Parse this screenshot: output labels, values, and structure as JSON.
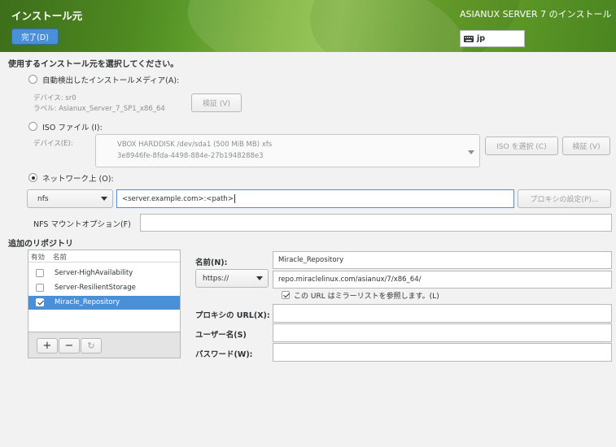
{
  "header": {
    "title": "インストール元",
    "done_label": "完了(D)",
    "product_title": "ASIANUX SERVER 7 のインストール",
    "keyboard_layout": "jp"
  },
  "source": {
    "heading": "使用するインストール元を選択してください。",
    "auto": {
      "label": "自動検出したインストールメディア(A):",
      "device_line": "デバイス: sr0",
      "label_line": "ラベル: Asianux_Server_7_SP1_x86_64",
      "verify_label": "検証 (V)"
    },
    "iso": {
      "label": "ISO ファイル (I):",
      "device_label": "デバイス(E):",
      "device_line1": "VBOX HARDDISK /dev/sda1 (500 MiB MB) xfs",
      "device_line2": "3e8946fe-8fda-4498-884e-27b1948288e3",
      "select_iso_label": "ISO を選択 (C)",
      "verify_label": "検証 (V)"
    },
    "network": {
      "label": "ネットワーク上 (O):",
      "protocol": "nfs",
      "url_value": "<server.example.com>:<path>",
      "proxy_label": "プロキシの設定(P)...",
      "nfs_options_label": "NFS マウントオプション(F)",
      "nfs_options_value": ""
    },
    "selected": "network"
  },
  "repos": {
    "heading": "追加のリポジトリ",
    "col_enabled": "有効",
    "col_name": "名前",
    "items": [
      {
        "name": "Server-HighAvailability",
        "enabled": false
      },
      {
        "name": "Server-ResilientStorage",
        "enabled": false
      },
      {
        "name": "Miracle_Repository",
        "enabled": true,
        "selected": true
      }
    ],
    "add_symbol": "+",
    "remove_symbol": "−",
    "reset_symbol": "↻"
  },
  "repo_detail": {
    "name_label": "名前(N):",
    "name_value": "Miracle_Repository",
    "protocol": "https://",
    "url_value": "repo.miraclelinux.com/asianux/7/x86_64/",
    "mirrorlist_label": "この URL はミラーリストを参照します。(L)",
    "mirrorlist_checked": true,
    "proxy_url_label": "プロキシの URL(X):",
    "proxy_url_value": "",
    "username_label": "ユーザー名(S)",
    "username_value": "",
    "password_label": "パスワード(W):",
    "password_value": ""
  },
  "colors": {
    "accent": "#4a90d9",
    "header_green": "#5b9a2a"
  }
}
